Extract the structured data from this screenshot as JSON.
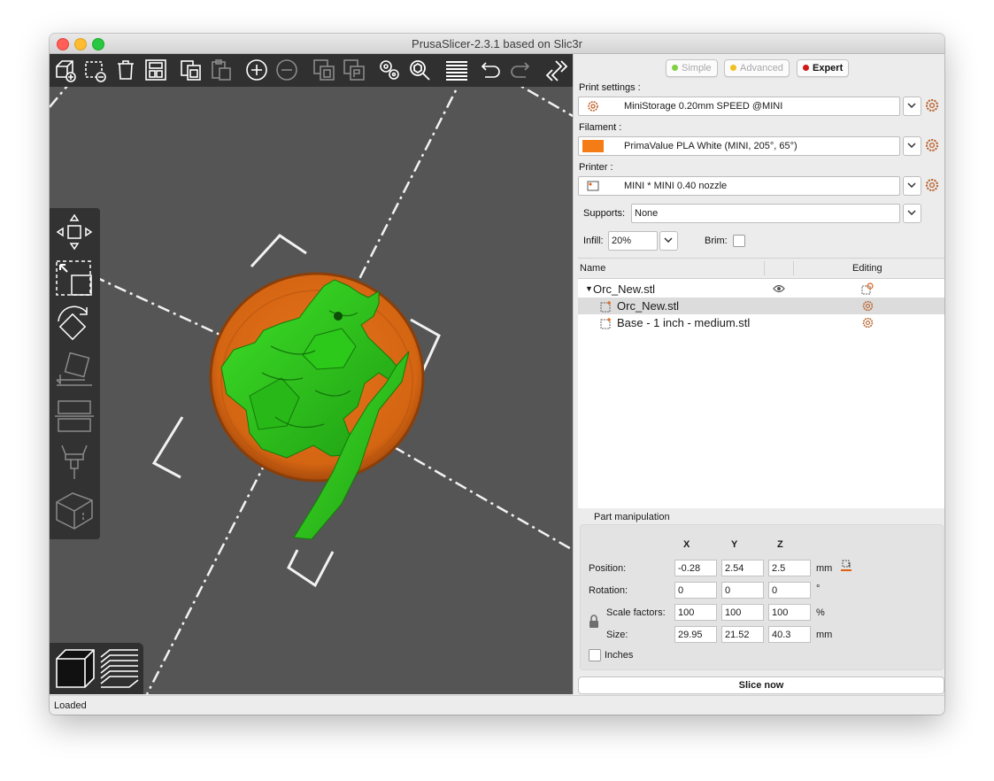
{
  "window": {
    "title": "PrusaSlicer-2.3.1 based on Slic3r"
  },
  "toolbar": {
    "icons": [
      "add-icon",
      "delete-icon",
      "delete-all-icon",
      "arrange-icon",
      "copy-icon",
      "paste-icon",
      "add-instance-icon",
      "remove-instance-icon",
      "split-objects-icon",
      "split-parts-icon",
      "layers-editing-icon",
      "search-icon",
      "variable-layer-height-icon",
      "undo-icon",
      "redo-icon",
      "collapse-sidebar-icon"
    ]
  },
  "left_tools": [
    "move-icon",
    "scale-icon",
    "rotate-icon",
    "place-on-face-icon",
    "cut-icon",
    "paint-supports-icon",
    "seam-painting-icon"
  ],
  "view_toggle": [
    "3d-view-icon",
    "preview-icon"
  ],
  "modes": [
    {
      "label": "Simple",
      "color": "#80d040"
    },
    {
      "label": "Advanced",
      "color": "#f0c020"
    },
    {
      "label": "Expert",
      "color": "#d01818",
      "active": true
    }
  ],
  "presets": {
    "print": {
      "label": "Print settings :",
      "value": "MiniStorage 0.20mm SPEED @MINI"
    },
    "filament": {
      "label": "Filament :",
      "value": "PrimaValue PLA White (MINI, 205°, 65°)",
      "color": "#f47c16"
    },
    "printer": {
      "label": "Printer :",
      "value": "MINI * MINI 0.40 nozzle"
    }
  },
  "supports": {
    "label": "Supports:",
    "value": "None"
  },
  "infill": {
    "label": "Infill:",
    "value": "20%"
  },
  "brim": {
    "label": "Brim:",
    "checked": false
  },
  "object_list": {
    "headers": {
      "name": "Name",
      "editing": "Editing"
    },
    "rows": [
      {
        "name": "Orc_New.stl"
      },
      {
        "name": "Orc_New.stl",
        "selected": true
      },
      {
        "name": "Base - 1 inch - medium.stl"
      }
    ]
  },
  "part_manipulation": {
    "title": "Part manipulation",
    "axes": [
      "X",
      "Y",
      "Z"
    ],
    "position": {
      "label": "Position:",
      "values": [
        "-0.28",
        "2.54",
        "2.5"
      ],
      "unit": "mm"
    },
    "rotation": {
      "label": "Rotation:",
      "values": [
        "0",
        "0",
        "0"
      ],
      "unit": "°"
    },
    "scale": {
      "label": "Scale factors:",
      "values": [
        "100",
        "100",
        "100"
      ],
      "unit": "%"
    },
    "size": {
      "label": "Size:",
      "values": [
        "29.95",
        "21.52",
        "40.3"
      ],
      "unit": "mm"
    },
    "inches": {
      "label": "Inches",
      "checked": false
    }
  },
  "slice_button": "Slice now",
  "status": "Loaded"
}
